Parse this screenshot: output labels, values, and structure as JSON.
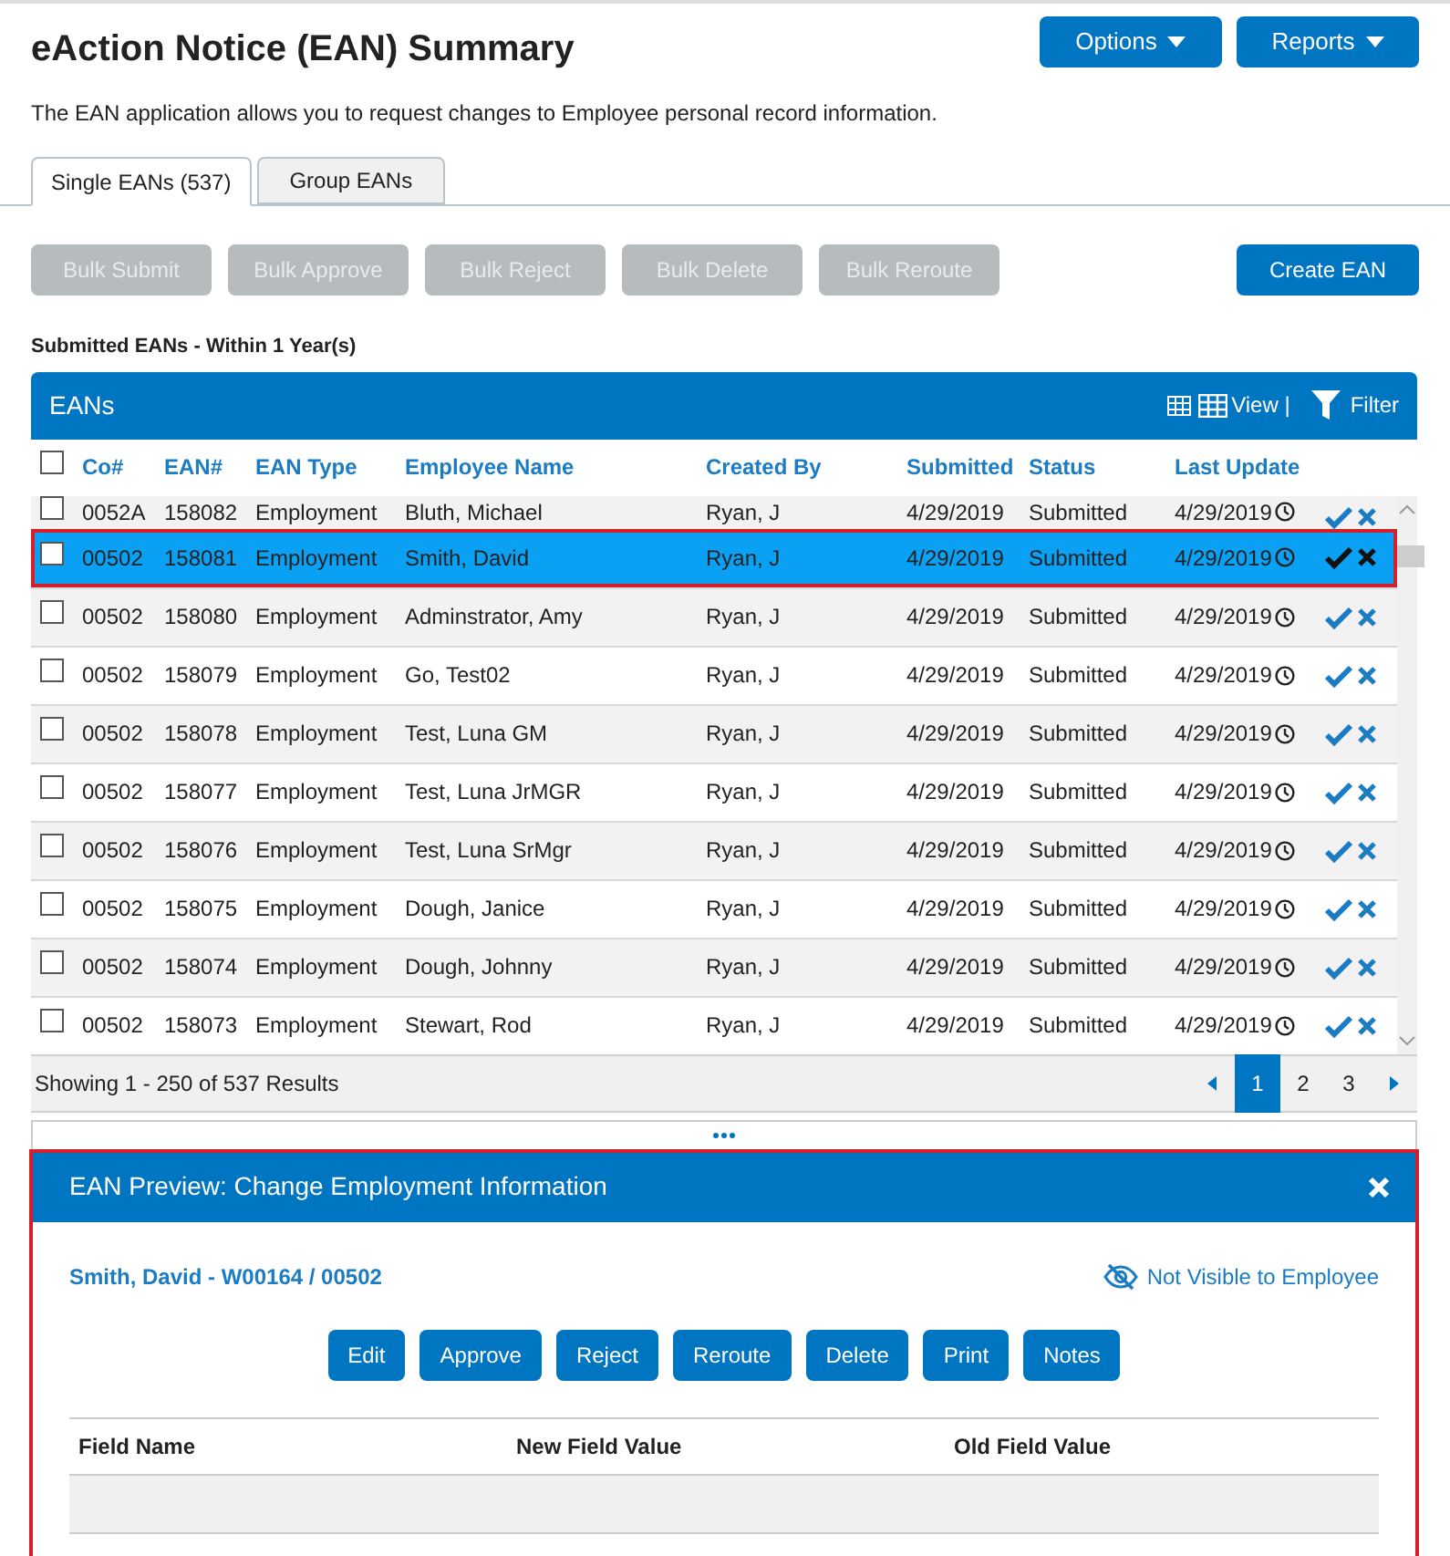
{
  "page": {
    "title": "eAction Notice (EAN) Summary",
    "description": "The EAN application allows you to request changes to Employee personal record information.",
    "menus": [
      {
        "label": "Options"
      },
      {
        "label": "Reports"
      }
    ]
  },
  "tabs": [
    {
      "label": "Single EANs (537)",
      "selected": true
    },
    {
      "label": "Group EANs",
      "selected": false
    }
  ],
  "bulk_buttons": [
    {
      "label": "Bulk Submit",
      "disabled": true
    },
    {
      "label": "Bulk Approve",
      "disabled": true
    },
    {
      "label": "Bulk Reject",
      "disabled": true
    },
    {
      "label": "Bulk Delete",
      "disabled": true
    },
    {
      "label": "Bulk Reroute",
      "disabled": true
    }
  ],
  "create_button": "Create EAN",
  "section_title": "Submitted EANs - Within 1 Year(s)",
  "table": {
    "title": "EANs",
    "view_label": "View |",
    "filter_label": "Filter",
    "select_all_checked": false,
    "columns": [
      "Co#",
      "EAN#",
      "EAN Type",
      "Employee Name",
      "Created By",
      "Submitted",
      "Status",
      "Last Update"
    ],
    "rows": [
      {
        "cells": [
          "0052A",
          "158082",
          "Employment",
          "Bluth, Michael",
          "Ryan, J",
          "4/29/2019",
          "Submitted",
          "4/29/2019"
        ],
        "checked": false,
        "selected": false
      },
      {
        "cells": [
          "00502",
          "158081",
          "Employment",
          "Smith, David",
          "Ryan, J",
          "4/29/2019",
          "Submitted",
          "4/29/2019"
        ],
        "checked": false,
        "selected": true
      },
      {
        "cells": [
          "00502",
          "158080",
          "Employment",
          "Adminstrator, Amy",
          "Ryan, J",
          "4/29/2019",
          "Submitted",
          "4/29/2019"
        ],
        "checked": false,
        "selected": false
      },
      {
        "cells": [
          "00502",
          "158079",
          "Employment",
          "Go, Test02",
          "Ryan, J",
          "4/29/2019",
          "Submitted",
          "4/29/2019"
        ],
        "checked": false,
        "selected": false
      },
      {
        "cells": [
          "00502",
          "158078",
          "Employment",
          "Test, Luna GM",
          "Ryan, J",
          "4/29/2019",
          "Submitted",
          "4/29/2019"
        ],
        "checked": false,
        "selected": false
      },
      {
        "cells": [
          "00502",
          "158077",
          "Employment",
          "Test, Luna JrMGR",
          "Ryan, J",
          "4/29/2019",
          "Submitted",
          "4/29/2019"
        ],
        "checked": false,
        "selected": false
      },
      {
        "cells": [
          "00502",
          "158076",
          "Employment",
          "Test, Luna SrMgr",
          "Ryan, J",
          "4/29/2019",
          "Submitted",
          "4/29/2019"
        ],
        "checked": false,
        "selected": false
      },
      {
        "cells": [
          "00502",
          "158075",
          "Employment",
          "Dough, Janice",
          "Ryan, J",
          "4/29/2019",
          "Submitted",
          "4/29/2019"
        ],
        "checked": false,
        "selected": false
      },
      {
        "cells": [
          "00502",
          "158074",
          "Employment",
          "Dough, Johnny",
          "Ryan, J",
          "4/29/2019",
          "Submitted",
          "4/29/2019"
        ],
        "checked": false,
        "selected": false
      },
      {
        "cells": [
          "00502",
          "158073",
          "Employment",
          "Stewart, Rod",
          "Ryan, J",
          "4/29/2019",
          "Submitted",
          "4/29/2019"
        ],
        "checked": false,
        "selected": false
      }
    ],
    "results": "Showing 1 - 250 of 537 Results",
    "pages": [
      {
        "label": "1",
        "selected": true
      },
      {
        "label": "2",
        "selected": false
      },
      {
        "label": "3",
        "selected": false
      }
    ]
  },
  "preview": {
    "title": "EAN Preview: Change Employment Information",
    "employee": "Smith, David - W00164 / 00502",
    "visibility": "Not Visible to Employee",
    "actions": [
      "Edit",
      "Approve",
      "Reject",
      "Reroute",
      "Delete",
      "Print",
      "Notes"
    ],
    "columns": [
      "Field Name",
      "New Field Value",
      "Old Field Value"
    ]
  }
}
